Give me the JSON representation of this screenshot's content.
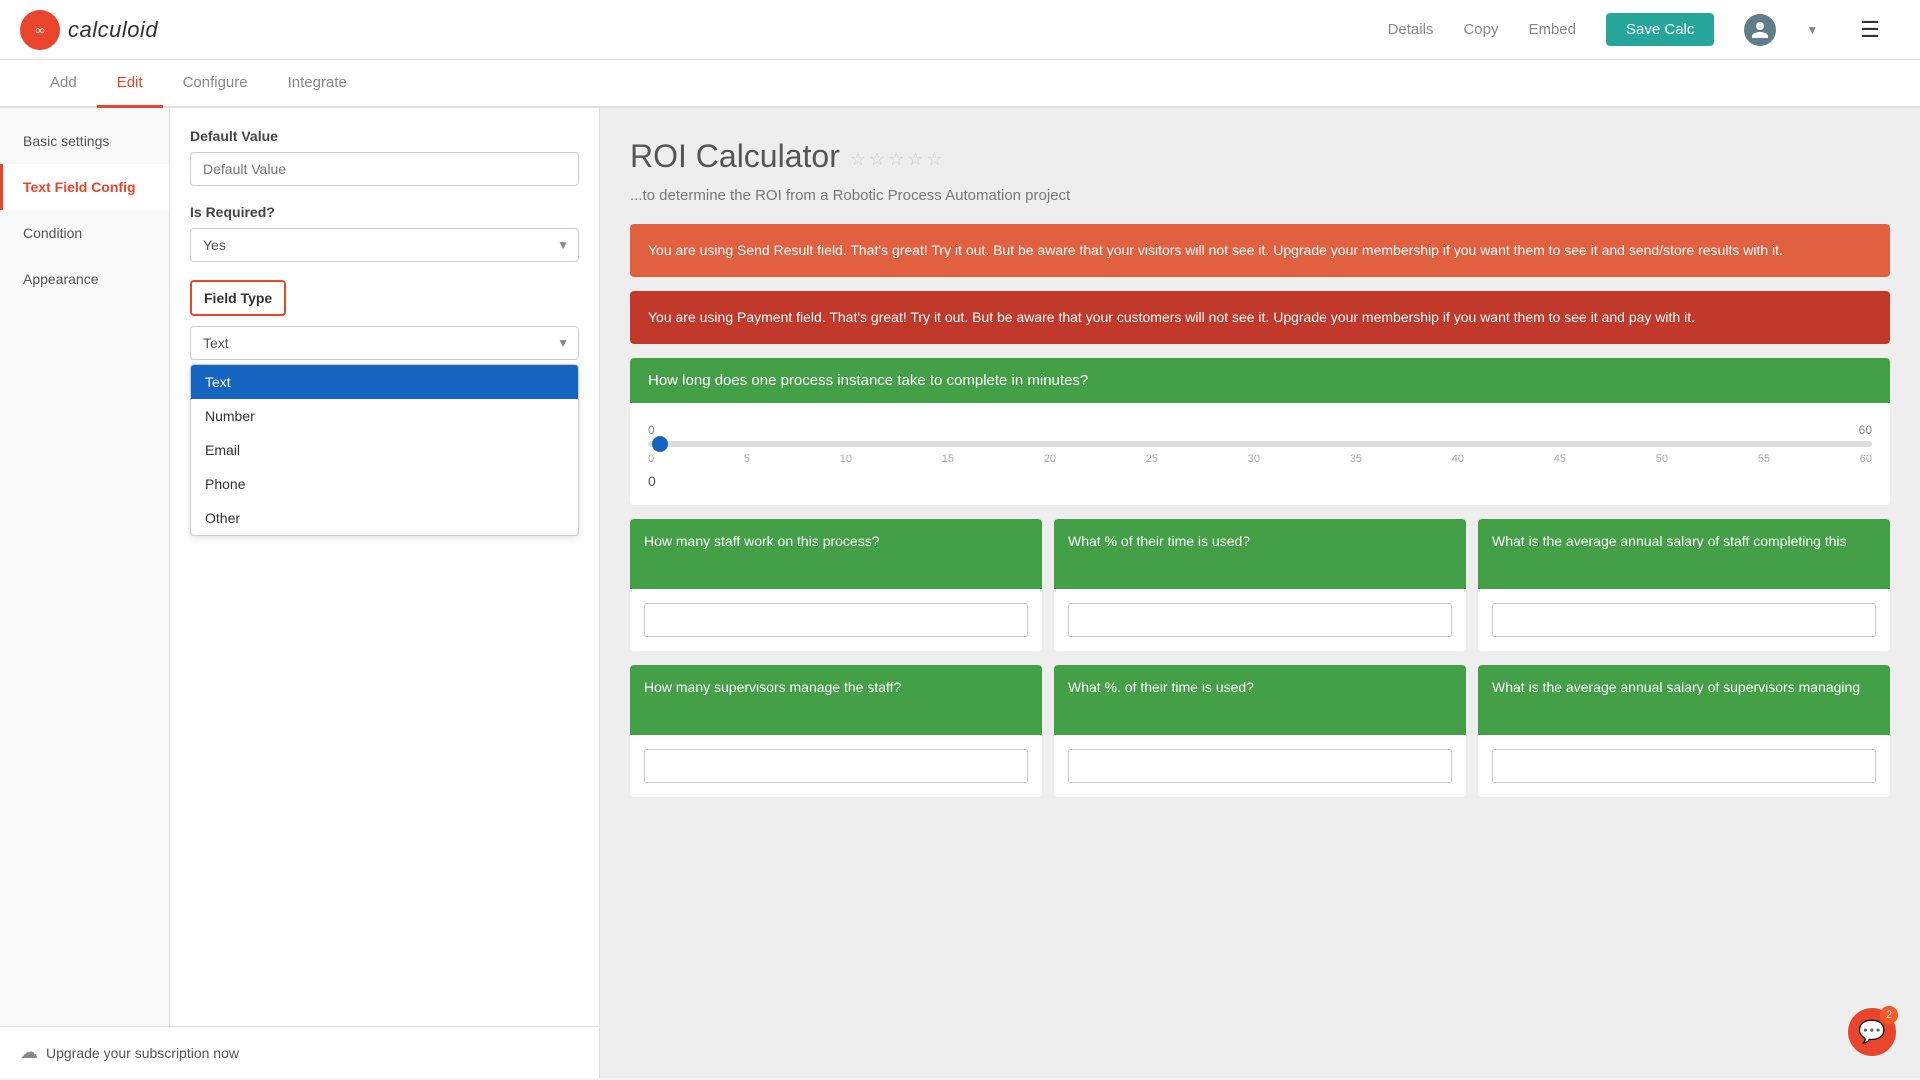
{
  "header": {
    "logo_text": "calculoid",
    "logo_symbol": "∞",
    "nav_details": "Details",
    "nav_copy": "Copy",
    "nav_embed": "Embed",
    "btn_save": "Save Calc"
  },
  "sub_nav": {
    "tabs": [
      "Add",
      "Edit",
      "Configure",
      "Integrate"
    ],
    "active_tab": "Edit"
  },
  "sidebar_nav": {
    "items": [
      {
        "label": "Basic settings",
        "id": "basic-settings"
      },
      {
        "label": "Text Field Config",
        "id": "text-field-config"
      },
      {
        "label": "Condition",
        "id": "condition"
      },
      {
        "label": "Appearance",
        "id": "appearance"
      }
    ],
    "active": "text-field-config"
  },
  "config_panel": {
    "default_value_label": "Default Value",
    "default_value_placeholder": "Default Value",
    "is_required_label": "Is Required?",
    "is_required_value": "Yes",
    "field_type_label": "Field Type",
    "field_type_value": "Text",
    "dropdown_options": [
      "Text",
      "Number",
      "Email",
      "Phone",
      "Other"
    ],
    "selected_option": "Text"
  },
  "bottom_bar": {
    "label": "Upgrade your subscription now"
  },
  "preview": {
    "title": "ROI Calculator",
    "subtitle": "...to determine the ROI from a Robotic Process Automation project",
    "stars": [
      "☆",
      "☆",
      "☆",
      "☆",
      "☆"
    ],
    "alert1": "You are using Send Result field. That's great! Try it out. But be aware that your visitors will not see it. Upgrade your membership if you want them to see it and send/store results with it.",
    "alert2": "You are using Payment field. That's great! Try it out. But be aware that your customers will not see it. Upgrade your membership if you want them to see it and pay with it.",
    "question1": "How long does one process instance take to complete in minutes?",
    "slider": {
      "min": "0",
      "max": "60",
      "value": "0",
      "ticks": [
        "0",
        "5",
        "10",
        "15",
        "20",
        "25",
        "30",
        "35",
        "40",
        "45",
        "50",
        "55",
        "60"
      ]
    },
    "cards_row1": [
      {
        "header": "How many staff work on this process?",
        "input_placeholder": ""
      },
      {
        "header": "What % of their time is used?",
        "input_placeholder": ""
      },
      {
        "header": "What is the average annual salary of staff completing this",
        "input_placeholder": ""
      }
    ],
    "cards_row2": [
      {
        "header": "How many supervisors manage the staff?",
        "input_placeholder": ""
      },
      {
        "header": "What %. of their time is used?",
        "input_placeholder": ""
      },
      {
        "header": "What is the average annual salary of supervisors managing",
        "input_placeholder": ""
      }
    ]
  },
  "chat": {
    "badge": "2"
  }
}
